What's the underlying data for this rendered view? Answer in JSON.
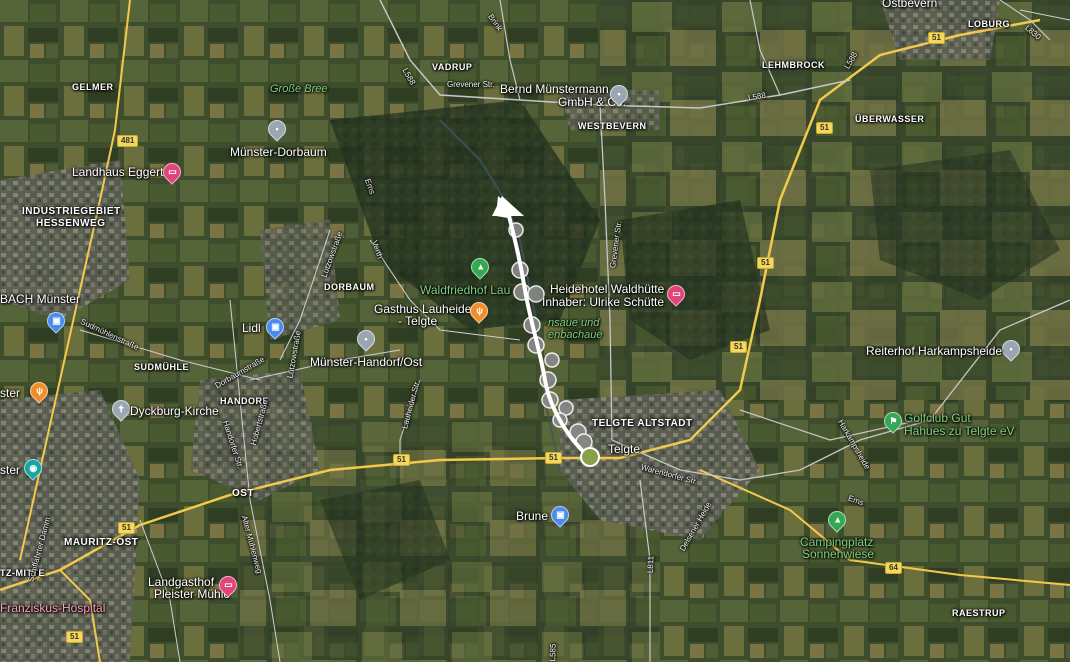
{
  "map": {
    "places": {
      "ostbevern": "Ostbevern",
      "loburg": "LOBURG",
      "gelmer": "GELMER",
      "vadrup": "VADRUP",
      "lehmbrock": "LEHMBROCK",
      "westbevern": "WESTBEVERN",
      "ueberwasser": "ÜBERWASSER",
      "industriegebiet": "INDUSTRIEGEBIET",
      "hessenweg": "HESSENWEG",
      "dorbaum": "DORBAUM",
      "sudmuhle": "SUDMÜHLE",
      "handorf": "HANDORF",
      "telgte_altstadt": "TELGTE ALTSTADT",
      "telgte": "Telgte",
      "ost": "OST",
      "mauritz_ost": "MAURITZ-OST",
      "tz_mitte": "TZ-MITTE",
      "raestrup": "RAESTRUP"
    },
    "pois": {
      "grosse_bree": "Große Bree",
      "muenster_dorbaum": "Münster-Dorbaum",
      "landhaus_eggert": "Landhaus Eggert",
      "bernd_line1": "Bernd Münstermann",
      "bernd_line2": "GmbH & Co.",
      "waldfriedhof": "Waldfriedhof Lau",
      "gasthus_line1": "Gasthus Lauheide",
      "gasthus_line2": "- Telgte",
      "heidehotel_line1": "Heidehotel Waldhütte",
      "heidehotel_line2": "Inhaber: Ulrike Schütte",
      "emsaue_line1": "nsaue und",
      "emsaue_line2": "enbachaue",
      "bach_muenster": "BACH Münster",
      "lidl": "Lidl",
      "muenster_handorf": "Münster-Handorf/Ost",
      "dyckburg": "Dyckburg-Kirche",
      "ster_left": "ster",
      "ster_left2": "ster",
      "reiterhof": "Reiterhof Harkampsheide",
      "golfclub_line1": "Golfclub Gut",
      "golfclub_line2": "Hahues zu Telgte eV",
      "brune": "Brune",
      "camping_line1": "Campingplatz",
      "camping_line2": "Sonnenwiese",
      "landgasthof_line1": "Landgasthof",
      "landgasthof_line2": "Pleister Mühle",
      "franziskus": "Franziskus-Hospital"
    },
    "roads": {
      "grevener_str": "Grevener Str.",
      "grevener_str_v": "Grevener Str.",
      "l588_a": "L588",
      "l588_b": "L588",
      "l588_c": "L588",
      "l830": "L830",
      "brink": "Brink",
      "ems": "Ems",
      "ems2": "Ems",
      "verth": "Verth",
      "lutzowstr": "Lützowstraße",
      "lutzowstr2": "Lützowstraße",
      "sudmuhlenstr": "Sudmühlenstraße",
      "dorbaumstr": "Dorbaumstraße",
      "hobertstr": "Hobertstraße",
      "handorfer_str": "Handorfer Str.",
      "laurheider_str": "Lauheider Str.",
      "warendorfer_str": "Warendorfer Str.",
      "delsener_heide": "Delsener Heide",
      "harkampsheide": "Harkampsheide",
      "l811": "L811",
      "alter_mühlenweg": "Alter Mühlenweg",
      "schiffahrter": "Schiffahrter Damm",
      "l585": "L585"
    },
    "shields": {
      "s481": "481",
      "s51_a": "51",
      "s51_b": "51",
      "s51_c": "51",
      "s51_d": "51",
      "s51_e": "51",
      "s51_f": "51",
      "s51_g": "51",
      "s51_h": "51",
      "s64": "64"
    },
    "colors": {
      "route": "#ffffff",
      "highway": "#f2c94c",
      "road": "#c7c7c7",
      "pin_grey": "#9aa7b2",
      "pin_pink": "#e0457a",
      "pin_blue": "#4a8bf0",
      "pin_orange": "#f08d2a",
      "pin_green": "#35a853"
    },
    "icons": [
      "pin-icon",
      "hotel-icon",
      "shopping-icon",
      "restaurant-icon",
      "church-icon",
      "park-icon",
      "golf-icon",
      "camping-icon",
      "museum-icon",
      "route-arrow-icon"
    ]
  }
}
